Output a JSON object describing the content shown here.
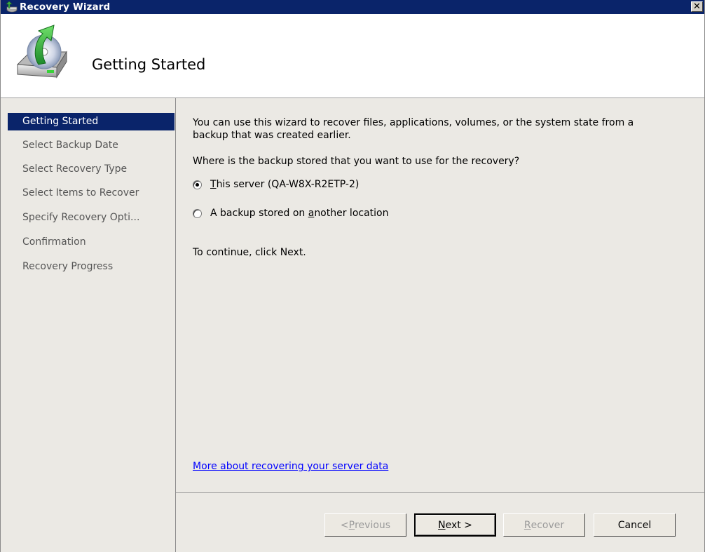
{
  "window": {
    "title": "Recovery Wizard",
    "close_glyph": "✕"
  },
  "header": {
    "title": "Getting Started",
    "icon": "backup-disk-restore-icon"
  },
  "nav": {
    "items": [
      {
        "label": "Getting Started",
        "active": true
      },
      {
        "label": "Select Backup Date",
        "active": false
      },
      {
        "label": "Select Recovery Type",
        "active": false
      },
      {
        "label": "Select Items to Recover",
        "active": false
      },
      {
        "label": "Specify Recovery Opti...",
        "active": false
      },
      {
        "label": "Confirmation",
        "active": false
      },
      {
        "label": "Recovery Progress",
        "active": false
      }
    ]
  },
  "content": {
    "intro_line1": "You can use this wizard to recover files, applications, volumes, or the system state from a",
    "intro_line2": "backup that was created earlier.",
    "question": "Where is the backup stored that you want to use for the recovery?",
    "options": [
      {
        "accel": "T",
        "rest": "his server (QA-W8X-R2ETP-2)",
        "checked": true
      },
      {
        "pre": "A backup stored on ",
        "accel": "a",
        "post": "nother location",
        "checked": false
      }
    ],
    "continue_text": "To continue, click Next.",
    "link_text": "More about recovering your server data"
  },
  "footer": {
    "previous": {
      "pre": "< ",
      "accel": "P",
      "post": "revious",
      "enabled": false
    },
    "next": {
      "accel": "N",
      "post": "ext >",
      "enabled": true
    },
    "recover": {
      "accel": "R",
      "post": "ecover",
      "enabled": false
    },
    "cancel": {
      "label": "Cancel",
      "enabled": true
    }
  },
  "colors": {
    "titlebar": "#0a246a",
    "nav_active": "#0a246a",
    "panel_bg": "#ebe9e4",
    "link": "#0000ff"
  }
}
